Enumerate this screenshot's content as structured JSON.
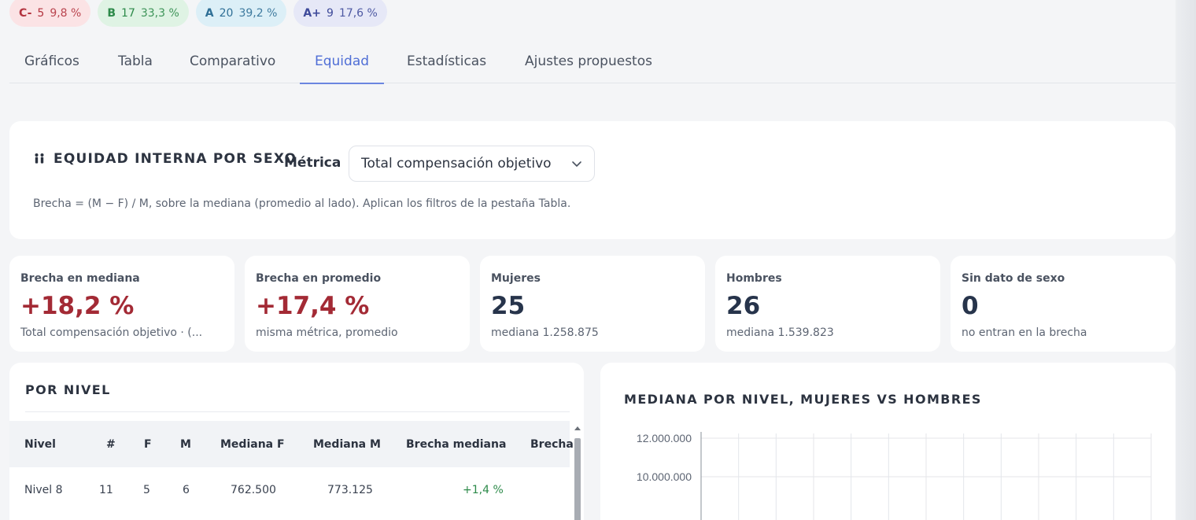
{
  "badges": [
    {
      "grade": "C-",
      "count": "5",
      "pct": "9,8 %"
    },
    {
      "grade": "B",
      "count": "17",
      "pct": "33,3 %"
    },
    {
      "grade": "A",
      "count": "20",
      "pct": "39,2 %"
    },
    {
      "grade": "A+",
      "count": "9",
      "pct": "17,6 %"
    }
  ],
  "tabs": [
    "Gráficos",
    "Tabla",
    "Comparativo",
    "Equidad",
    "Estadísticas",
    "Ajustes propuestos"
  ],
  "active_tab": "Equidad",
  "header": {
    "title": "EQUIDAD INTERNA POR SEXO",
    "metric_label": "Métrica",
    "metric_value": "Total compensación objetivo",
    "note": "Brecha = (M − F) / M, sobre la mediana (promedio al lado). Aplican los filtros de la pestaña Tabla."
  },
  "stats": [
    {
      "label": "Brecha en mediana",
      "value": "+18,2 %",
      "sub": "Total compensación objetivo · (..."
    },
    {
      "label": "Brecha en promedio",
      "value": "+17,4 %",
      "sub": "misma métrica, promedio"
    },
    {
      "label": "Mujeres",
      "value": "25",
      "sub": "mediana 1.258.875"
    },
    {
      "label": "Hombres",
      "value": "26",
      "sub": "mediana 1.539.823"
    },
    {
      "label": "Sin dato de sexo",
      "value": "0",
      "sub": "no entran en la brecha"
    }
  ],
  "table": {
    "title": "POR NIVEL",
    "headers": [
      "Nivel",
      "#",
      "F",
      "M",
      "Mediana F",
      "Mediana M",
      "Brecha mediana",
      "Brecha"
    ],
    "rows": [
      [
        "Nivel 8",
        "11",
        "5",
        "6",
        "762.500",
        "773.125",
        "+1,4 %",
        ""
      ]
    ]
  },
  "chart": {
    "title": "MEDIANA POR NIVEL, MUJERES VS HOMBRES"
  },
  "chart_data": {
    "type": "bar",
    "title": "MEDIANA POR NIVEL, MUJERES VS HOMBRES",
    "y_ticks": [
      "12.000.000",
      "10.000.000"
    ],
    "y_tick_values": [
      12000000,
      10000000
    ],
    "categories": [],
    "series": [],
    "grid": true
  },
  "colors": {
    "accent": "#4f6ed6",
    "negative": "#a32a35",
    "positive": "#2d8a4a"
  }
}
